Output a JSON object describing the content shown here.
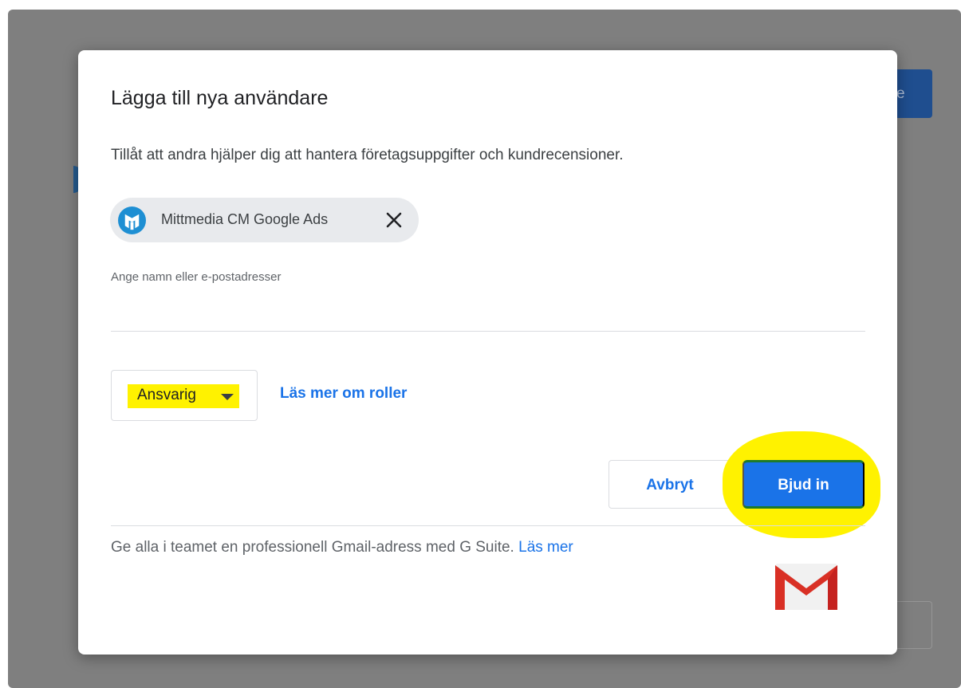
{
  "background": {
    "partial_button_label": "e"
  },
  "dialog": {
    "title": "Lägga till nya användare",
    "description": "Tillåt att andra hjälper dig att hantera företagsuppgifter och kundrecensioner.",
    "chip": {
      "label": "Mittmedia CM Google Ads",
      "avatar_icon": "mittmedia-logo-icon",
      "remove_icon": "close-icon"
    },
    "input_hint": "Ange namn eller e-postadresser",
    "role": {
      "selected": "Ansvarig",
      "caret_icon": "caret-down-icon"
    },
    "roles_link": "Läs mer om roller",
    "buttons": {
      "cancel": "Avbryt",
      "invite": "Bjud in"
    },
    "promo": {
      "text": "Ge alla i teamet en professionell Gmail-adress med G Suite. ",
      "link": "Läs mer",
      "icon": "gmail-icon"
    }
  },
  "colors": {
    "accent": "#1a73e8",
    "highlight": "#fff200",
    "overlay": "#7f7f7f"
  }
}
